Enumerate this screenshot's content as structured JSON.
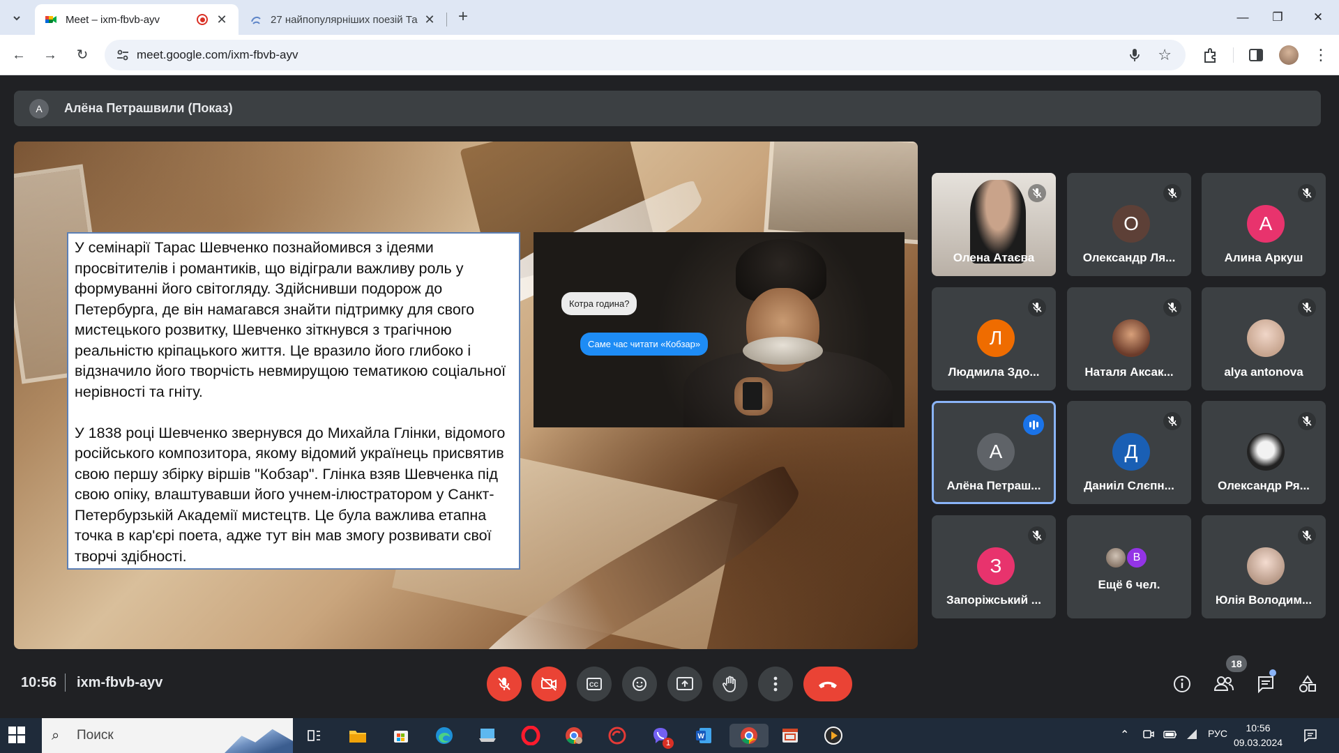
{
  "browser": {
    "tabs": [
      {
        "title": "Meet – ixm-fbvb-ayv",
        "active": true
      },
      {
        "title": "27 найпопулярніших поезій Та",
        "active": false
      }
    ],
    "url": "meet.google.com/ixm-fbvb-ayv"
  },
  "meet": {
    "presenter": {
      "initial": "A",
      "label": "Алёна Петрашвили (Показ)"
    },
    "slide": {
      "paragraphs": [
        "У семінарії Тарас Шевченко познайомився з ідеями просвітителів і романтиків, що відіграли важливу роль у формуванні його світогляду. Здійснивши подорож до Петербурга, де він намагався знайти підтримку для свого мистецького розвитку, Шевченко зіткнувся з трагічною реальністю кріпацького життя. Це вразило його глибоко і відзначило його творчість невмирущою тематикою соціальної нерівності та гніту.",
        "У 1838 році Шевченко звернувся до Михайла Глінки, відомого російського композитора, якому відомий українець присвятив свою першу збірку віршів \"Кобзар\". Глінка взяв Шевченка під свою опіку, влаштувавши його учнем-ілюстратором у Санкт-Петербурзькій Академії мистецтв. Це була важлива етапна точка в кар'єрі поета, адже тут він мав змогу розвивати свої творчі здібності."
      ],
      "bubble_question": "Котра година?",
      "bubble_answer": "Саме час читати «Кобзар»"
    },
    "participants": [
      {
        "name": "Олена Атаєва",
        "initial": "",
        "color": "",
        "type": "video"
      },
      {
        "name": "Олександр Ля...",
        "initial": "О",
        "color": "#5d4037",
        "type": "avatar"
      },
      {
        "name": "Алина Аркуш",
        "initial": "А",
        "color": "#e8336d",
        "type": "avatar"
      },
      {
        "name": "Людмила Здо...",
        "initial": "Л",
        "color": "#ef6c00",
        "type": "avatar"
      },
      {
        "name": "Наталя Аксак...",
        "initial": "",
        "color": "",
        "type": "photo"
      },
      {
        "name": "alya antonova",
        "initial": "",
        "color": "",
        "type": "photo"
      },
      {
        "name": "Алёна Петраш...",
        "initial": "А",
        "color": "#5f6368",
        "type": "avatar",
        "speaking": true
      },
      {
        "name": "Даниіл Слєпн...",
        "initial": "Д",
        "color": "#1a5fb4",
        "type": "avatar"
      },
      {
        "name": "Олександр Ря...",
        "initial": "",
        "color": "",
        "type": "photo"
      },
      {
        "name": "Запоріжський ...",
        "initial": "З",
        "color": "#e8336d",
        "type": "avatar"
      },
      {
        "name": "Ещё 6 чел.",
        "initial": "В",
        "color": "#9334e6",
        "type": "more"
      },
      {
        "name": "Юлія Володим...",
        "initial": "",
        "color": "",
        "type": "photo"
      }
    ],
    "bottom": {
      "time": "10:56",
      "code": "ixm-fbvb-ayv",
      "people_count": "18"
    }
  },
  "taskbar": {
    "search_placeholder": "Поиск",
    "language": "РУС",
    "clock_time": "10:56",
    "clock_date": "09.03.2024",
    "viber_badge": "1"
  }
}
